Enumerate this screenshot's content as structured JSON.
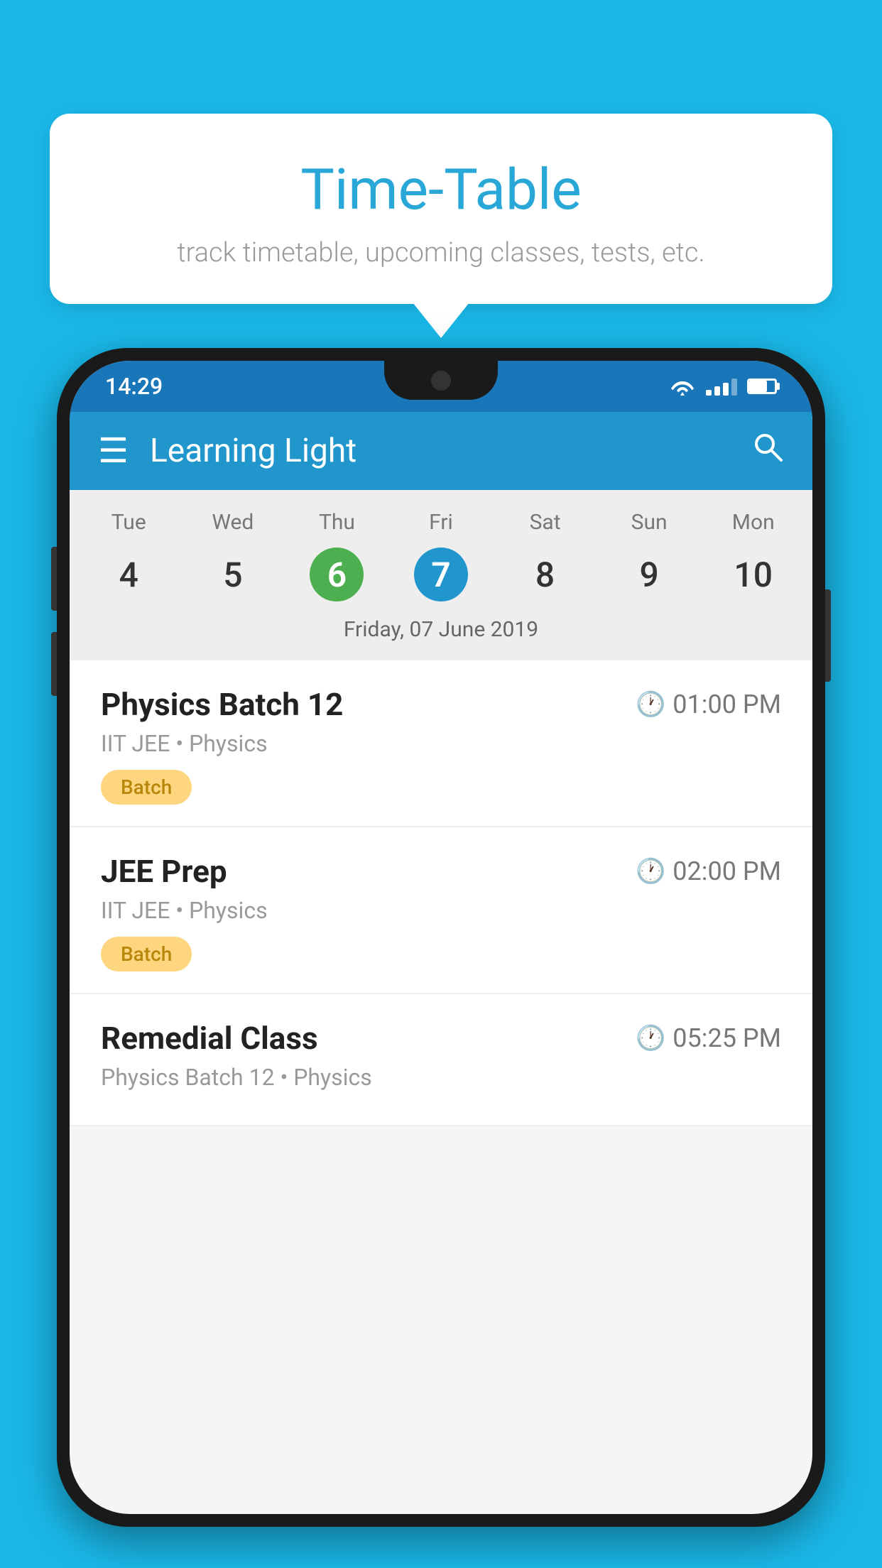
{
  "background_color": "#1ab8e8",
  "tooltip": {
    "title": "Time-Table",
    "subtitle": "track timetable, upcoming classes, tests, etc."
  },
  "phone": {
    "status_bar": {
      "time": "14:29"
    },
    "app_bar": {
      "title": "Learning Light"
    },
    "calendar": {
      "days": [
        {
          "label": "Tue",
          "num": "4",
          "state": "normal"
        },
        {
          "label": "Wed",
          "num": "5",
          "state": "normal"
        },
        {
          "label": "Thu",
          "num": "6",
          "state": "today"
        },
        {
          "label": "Fri",
          "num": "7",
          "state": "selected"
        },
        {
          "label": "Sat",
          "num": "8",
          "state": "normal"
        },
        {
          "label": "Sun",
          "num": "9",
          "state": "normal"
        },
        {
          "label": "Mon",
          "num": "10",
          "state": "normal"
        }
      ],
      "selected_date_label": "Friday, 07 June 2019"
    },
    "schedule": [
      {
        "title": "Physics Batch 12",
        "time": "01:00 PM",
        "sub": "IIT JEE • Physics",
        "tag": "Batch"
      },
      {
        "title": "JEE Prep",
        "time": "02:00 PM",
        "sub": "IIT JEE • Physics",
        "tag": "Batch"
      },
      {
        "title": "Remedial Class",
        "time": "05:25 PM",
        "sub": "Physics Batch 12 • Physics",
        "tag": ""
      }
    ]
  }
}
